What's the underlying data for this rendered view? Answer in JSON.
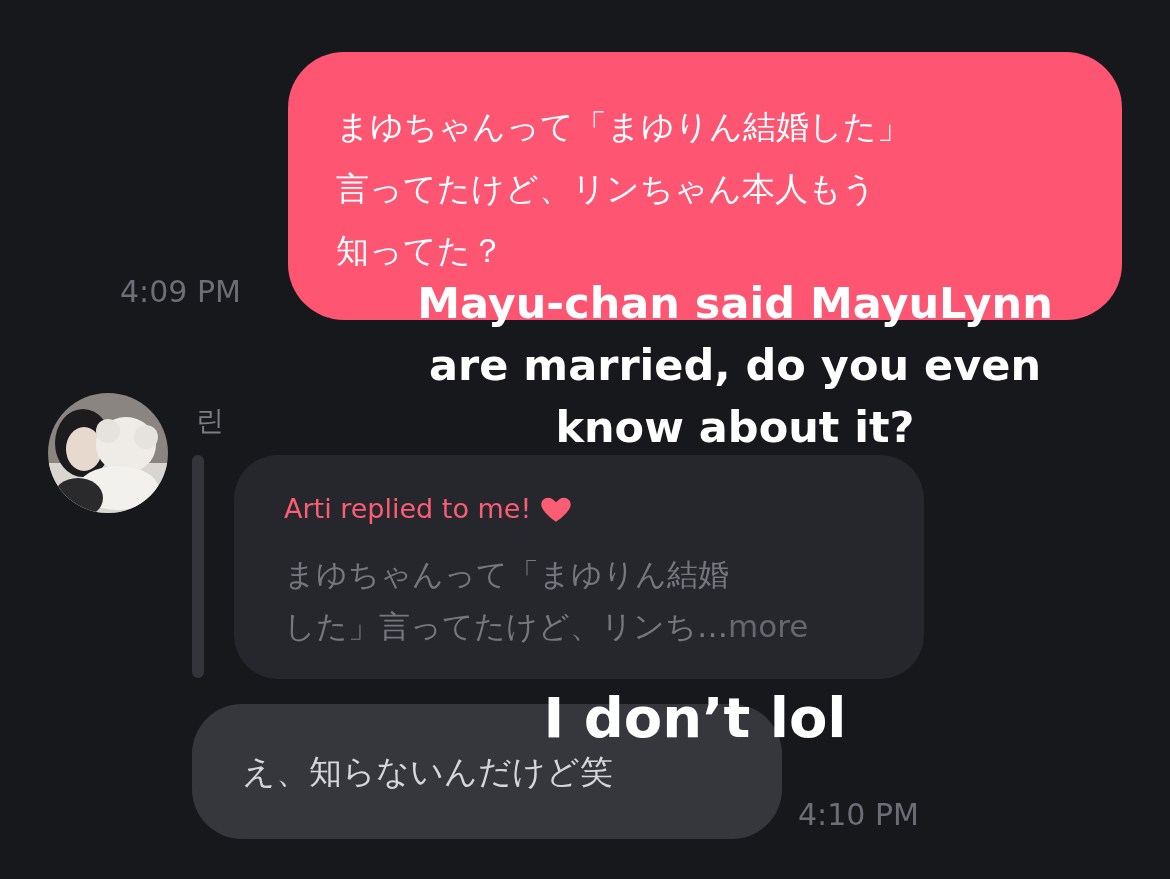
{
  "sent_message": {
    "lines": [
      "まゆちゃんって「まゆりん結婚した」",
      "言ってたけど、リンちゃん本人もう",
      "知ってた？"
    ],
    "time": "4:09 PM"
  },
  "received": {
    "sender": "린",
    "reply_quote": {
      "title": "Arti replied to me!",
      "lines": [
        "まゆちゃんって「まゆりん結婚",
        "した」言ってたけど、リンち…"
      ],
      "more": "more"
    },
    "message": "え、知らないんだけど笑",
    "time": "4:10 PM"
  },
  "captions": [
    {
      "lines": [
        "Mayu-chan said MayuLynn",
        "are married, do you even",
        "know about it?"
      ]
    },
    {
      "lines": [
        "I don’t lol"
      ]
    }
  ]
}
